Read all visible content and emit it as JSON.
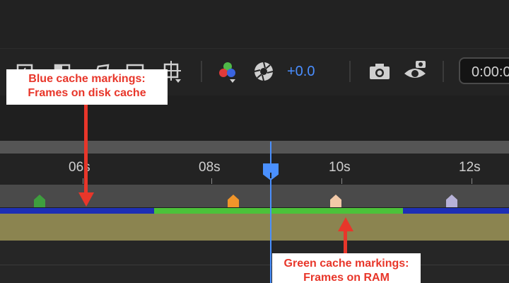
{
  "toolbar": {
    "exposure_value": "+0.0",
    "timecode": "0:00:0",
    "icons": [
      "region-of-interest-icon",
      "transparency-grid-icon",
      "mask-path-icon",
      "safe-margins-icon",
      "crosshair-grid-icon",
      "channel-rgb-icon",
      "exposure-shutter-icon",
      "snapshot-camera-icon",
      "show-snapshot-icon"
    ]
  },
  "ruler": {
    "ticks": [
      "06s",
      "08s",
      "10s",
      "12s"
    ]
  },
  "markers": [
    {
      "color": "#3e9e3e"
    },
    {
      "color": "#f0952a"
    },
    {
      "color": "#f2c9a8"
    },
    {
      "color": "#b7b2d8"
    }
  ],
  "cache": {
    "disk_color": "#1e2fb5",
    "ram_color": "#4cc23a"
  },
  "callouts": {
    "blue_line1": "Blue cache markings:",
    "blue_line2": "Frames on disk cache",
    "green_line1": "Green cache markings:",
    "green_line2": "Frames on RAM"
  },
  "colors": {
    "annotation_red": "#e8362a",
    "playhead_blue": "#4a90ff",
    "layer_bar": "#8b8450"
  }
}
